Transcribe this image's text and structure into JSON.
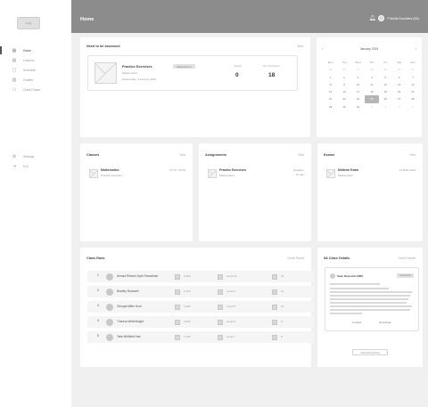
{
  "sidebar": {
    "logo": "Logo",
    "items": [
      {
        "label": "Home",
        "icon": "home-icon",
        "glyph": "▦",
        "active": true
      },
      {
        "label": "Lessons",
        "icon": "book-icon",
        "glyph": "▤",
        "active": false
      },
      {
        "label": "Schedule",
        "icon": "calendar-icon",
        "glyph": "▢",
        "active": false
      },
      {
        "label": "Grades",
        "icon": "grades-icon",
        "glyph": "▥",
        "active": false
      },
      {
        "label": "Class Roster",
        "icon": "people-icon",
        "glyph": "⚇",
        "active": false
      }
    ],
    "bottom_items": [
      {
        "label": "Settings",
        "icon": "gear-icon",
        "glyph": "⚙"
      },
      {
        "label": "Exit",
        "icon": "exit-icon",
        "glyph": "⇥"
      }
    ]
  },
  "header": {
    "title": "Home",
    "user_name": "Priscilla Saunders (5A)"
  },
  "assess": {
    "title": "Need to be assessed",
    "link": "View",
    "item_title": "Practice Exercises",
    "badge": "Assignment 1",
    "subject": "Mathematics",
    "date": "Wednesday, 3 January 2024",
    "stat1_label": "Rated",
    "stat1_value": "0",
    "stat2_label": "Not Yet Rated",
    "stat2_value": "18"
  },
  "calendar": {
    "month": "January 2024",
    "prev": "‹",
    "next": "›",
    "dow": [
      "Mon",
      "Tue",
      "Wed",
      "Thu",
      "Fri",
      "Sat",
      "Sun"
    ],
    "weeks": [
      [
        "25",
        "26",
        "27",
        "28",
        "29",
        "30",
        "31"
      ],
      [
        "1",
        "2",
        "3",
        "4",
        "5",
        "6",
        "7"
      ],
      [
        "8",
        "9",
        "10",
        "11",
        "12",
        "13",
        "14"
      ],
      [
        "15",
        "16",
        "17",
        "18",
        "19",
        "20",
        "21"
      ],
      [
        "22",
        "23",
        "24",
        "25",
        "26",
        "27",
        "28"
      ],
      [
        "29",
        "30",
        "31",
        "1",
        "2",
        "3",
        "4"
      ]
    ],
    "today": "25"
  },
  "classes": {
    "title": "Classes",
    "link": "View",
    "item_title": "Mathematics",
    "item_sub": "Priscilla Saunders",
    "item_time": "07.30 - 09.00"
  },
  "assignments": {
    "title": "Assignments",
    "link": "View",
    "item_title": "Practice Exercises",
    "item_sub": "Mathematics",
    "deadline_label": "Deadline",
    "deadline": "10 Jan"
  },
  "exams": {
    "title": "Exams",
    "link": "View",
    "item_title": "Midterm Exam",
    "item_sub": "Mathematics",
    "item_date": "15 MAR 2024"
  },
  "rank": {
    "title": "Class Rank",
    "link": "Check Ranks",
    "rows": [
      {
        "num": "1",
        "name": "Ahmad Ridwan Syah Ramadhan",
        "score": "2,350",
        "level": "Level 10",
        "count": "12"
      },
      {
        "num": "2",
        "name": "Bradley Rockwell",
        "score": "2,100",
        "level": "Level 9",
        "count": "11"
      },
      {
        "num": "3",
        "name": "Georgia Miller Hunt",
        "score": "1,950",
        "level": "Level 8",
        "count": "10"
      },
      {
        "num": "4",
        "name": "Theresa Wheelwright",
        "score": "1,820",
        "level": "Level 8",
        "count": "9"
      },
      {
        "num": "5",
        "name": "Talia Whitfield Hart",
        "score": "1,700",
        "level": "Level 7",
        "count": "8"
      }
    ]
  },
  "details": {
    "title": "5A Class Details",
    "link": "Check Details",
    "name": "Sean Reynolds (NIP)",
    "badge": "Homeroom",
    "btn_contact": "Contact",
    "btn_download": "Download",
    "view_all": "View Everything"
  }
}
